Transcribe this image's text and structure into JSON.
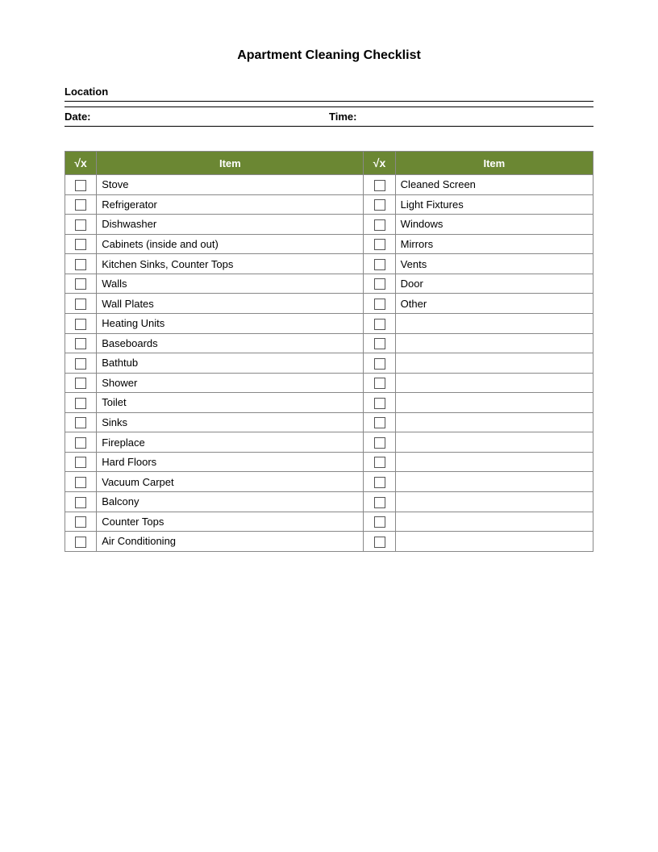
{
  "page": {
    "title": "Apartment Cleaning Checklist",
    "location_label": "Location",
    "date_label": "Date:",
    "time_label": "Time:"
  },
  "table": {
    "header": {
      "check_symbol": "√x",
      "item_label": "Item"
    },
    "left_items": [
      "Stove",
      "Refrigerator",
      "Dishwasher",
      "Cabinets  (inside and out)",
      "Kitchen Sinks, Counter Tops",
      "Walls",
      "Wall Plates",
      "Heating Units",
      "Baseboards",
      "Bathtub",
      "Shower",
      "Toilet",
      "Sinks",
      "Fireplace",
      "Hard Floors",
      "Vacuum Carpet",
      "Balcony",
      "Counter Tops",
      "Air Conditioning"
    ],
    "right_items": [
      "Cleaned Screen",
      "Light Fixtures",
      "Windows",
      "Mirrors",
      "Vents",
      "Door",
      "Other",
      "",
      "",
      "",
      "",
      "",
      "",
      "",
      "",
      "",
      "",
      "",
      ""
    ]
  }
}
